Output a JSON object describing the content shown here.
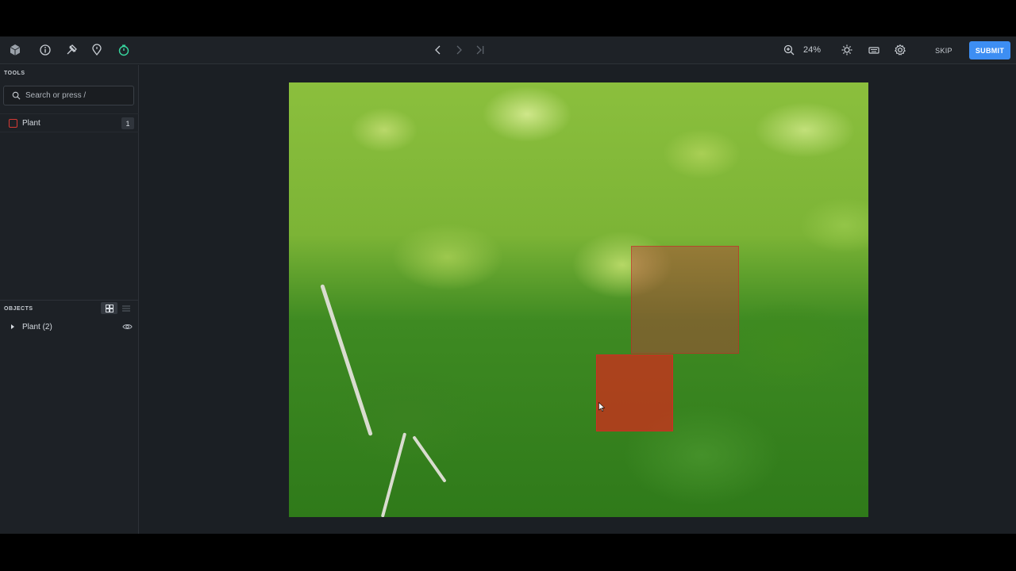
{
  "toolbar": {
    "left_icons": [
      "logo-cube-icon",
      "info-icon",
      "history-icon",
      "location-pin-icon",
      "timer-icon"
    ],
    "nav_icons": [
      "chevron-left-icon",
      "chevron-right-icon",
      "skip-to-end-icon"
    ],
    "zoom": "24%",
    "skip_label": "SKIP",
    "submit_label": "SUBMIT",
    "accent": "#3d8ef3"
  },
  "sidebar": {
    "tools_title": "TOOLS",
    "search": {
      "placeholder": "Search or press /",
      "value": ""
    },
    "tools": [
      {
        "label": "Plant",
        "count": "1",
        "color": "#d63a34"
      }
    ],
    "objects_title": "OBJECTS",
    "objects": [
      {
        "label": "Plant (2)"
      }
    ]
  },
  "canvas": {
    "annotations": [
      {
        "class": "Plant",
        "state": "inactive"
      },
      {
        "class": "Plant",
        "state": "selected"
      }
    ]
  }
}
